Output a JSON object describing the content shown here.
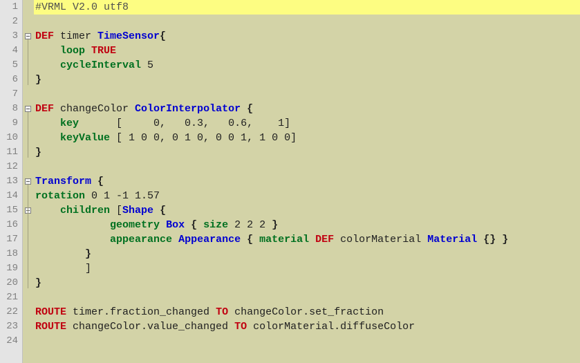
{
  "lineCount": 24,
  "highlightLine": 1,
  "foldMarks": [
    3,
    8,
    13,
    15
  ],
  "foldRanges": [
    [
      3,
      6
    ],
    [
      8,
      11
    ],
    [
      13,
      20
    ],
    [
      15,
      19
    ]
  ],
  "lines": {
    "L1": {
      "tokens": [
        {
          "cls": "comment",
          "t": "#VRML V2.0 utf8"
        }
      ]
    },
    "L2": {
      "tokens": []
    },
    "L3": {
      "tokens": [
        {
          "cls": "kw-red",
          "t": "DEF"
        },
        {
          "cls": "plain",
          "t": " timer "
        },
        {
          "cls": "kw-blue",
          "t": "TimeSensor"
        },
        {
          "cls": "brace",
          "t": "{"
        }
      ]
    },
    "L4": {
      "tokens": [
        {
          "cls": "plain",
          "t": "    "
        },
        {
          "cls": "kw-green",
          "t": "loop"
        },
        {
          "cls": "plain",
          "t": " "
        },
        {
          "cls": "kw-red",
          "t": "TRUE"
        }
      ]
    },
    "L5": {
      "tokens": [
        {
          "cls": "plain",
          "t": "    "
        },
        {
          "cls": "kw-green",
          "t": "cycleInterval"
        },
        {
          "cls": "plain",
          "t": " 5"
        }
      ]
    },
    "L6": {
      "tokens": [
        {
          "cls": "brace",
          "t": "}"
        }
      ]
    },
    "L7": {
      "tokens": []
    },
    "L8": {
      "tokens": [
        {
          "cls": "kw-red",
          "t": "DEF"
        },
        {
          "cls": "plain",
          "t": " changeColor "
        },
        {
          "cls": "kw-blue",
          "t": "ColorInterpolator"
        },
        {
          "cls": "plain",
          "t": " "
        },
        {
          "cls": "brace",
          "t": "{"
        }
      ]
    },
    "L9": {
      "tokens": [
        {
          "cls": "plain",
          "t": "    "
        },
        {
          "cls": "kw-green",
          "t": "key"
        },
        {
          "cls": "plain",
          "t": "      [     0,   0.3,   0.6,    1]"
        }
      ]
    },
    "L10": {
      "tokens": [
        {
          "cls": "plain",
          "t": "    "
        },
        {
          "cls": "kw-green",
          "t": "keyValue"
        },
        {
          "cls": "plain",
          "t": " [ 1 0 0, 0 1 0, 0 0 1, 1 0 0]"
        }
      ]
    },
    "L11": {
      "tokens": [
        {
          "cls": "brace",
          "t": "}"
        }
      ]
    },
    "L12": {
      "tokens": []
    },
    "L13": {
      "tokens": [
        {
          "cls": "kw-blue",
          "t": "Transform"
        },
        {
          "cls": "plain",
          "t": " "
        },
        {
          "cls": "brace",
          "t": "{"
        }
      ]
    },
    "L14": {
      "tokens": [
        {
          "cls": "kw-green",
          "t": "rotation"
        },
        {
          "cls": "plain",
          "t": " 0 1 -1 1.57"
        }
      ]
    },
    "L15": {
      "tokens": [
        {
          "cls": "plain",
          "t": "    "
        },
        {
          "cls": "kw-green",
          "t": "children"
        },
        {
          "cls": "plain",
          "t": " ["
        },
        {
          "cls": "kw-blue",
          "t": "Shape"
        },
        {
          "cls": "plain",
          "t": " "
        },
        {
          "cls": "brace",
          "t": "{"
        }
      ]
    },
    "L16": {
      "tokens": [
        {
          "cls": "plain",
          "t": "            "
        },
        {
          "cls": "kw-green",
          "t": "geometry"
        },
        {
          "cls": "plain",
          "t": " "
        },
        {
          "cls": "kw-blue",
          "t": "Box"
        },
        {
          "cls": "plain",
          "t": " "
        },
        {
          "cls": "brace",
          "t": "{"
        },
        {
          "cls": "plain",
          "t": " "
        },
        {
          "cls": "kw-green",
          "t": "size"
        },
        {
          "cls": "plain",
          "t": " 2 2 2 "
        },
        {
          "cls": "brace",
          "t": "}"
        }
      ]
    },
    "L17": {
      "tokens": [
        {
          "cls": "plain",
          "t": "            "
        },
        {
          "cls": "kw-green",
          "t": "appearance"
        },
        {
          "cls": "plain",
          "t": " "
        },
        {
          "cls": "kw-blue",
          "t": "Appearance"
        },
        {
          "cls": "plain",
          "t": " "
        },
        {
          "cls": "brace",
          "t": "{"
        },
        {
          "cls": "plain",
          "t": " "
        },
        {
          "cls": "kw-green",
          "t": "material"
        },
        {
          "cls": "plain",
          "t": " "
        },
        {
          "cls": "kw-red",
          "t": "DEF"
        },
        {
          "cls": "plain",
          "t": " colorMaterial "
        },
        {
          "cls": "kw-blue",
          "t": "Material"
        },
        {
          "cls": "plain",
          "t": " "
        },
        {
          "cls": "brace",
          "t": "{}"
        },
        {
          "cls": "plain",
          "t": " "
        },
        {
          "cls": "brace",
          "t": "}"
        }
      ]
    },
    "L18": {
      "tokens": [
        {
          "cls": "plain",
          "t": "        "
        },
        {
          "cls": "brace",
          "t": "}"
        }
      ]
    },
    "L19": {
      "tokens": [
        {
          "cls": "plain",
          "t": "        ]"
        }
      ]
    },
    "L20": {
      "tokens": [
        {
          "cls": "brace",
          "t": "}"
        }
      ]
    },
    "L21": {
      "tokens": []
    },
    "L22": {
      "tokens": [
        {
          "cls": "kw-red",
          "t": "ROUTE"
        },
        {
          "cls": "plain",
          "t": " timer.fraction_changed "
        },
        {
          "cls": "kw-red",
          "t": "TO"
        },
        {
          "cls": "plain",
          "t": " changeColor.set_fraction"
        }
      ]
    },
    "L23": {
      "tokens": [
        {
          "cls": "kw-red",
          "t": "ROUTE"
        },
        {
          "cls": "plain",
          "t": " changeColor.value_changed "
        },
        {
          "cls": "kw-red",
          "t": "TO"
        },
        {
          "cls": "plain",
          "t": " colorMaterial.diffuseColor"
        }
      ]
    },
    "L24": {
      "tokens": []
    }
  }
}
